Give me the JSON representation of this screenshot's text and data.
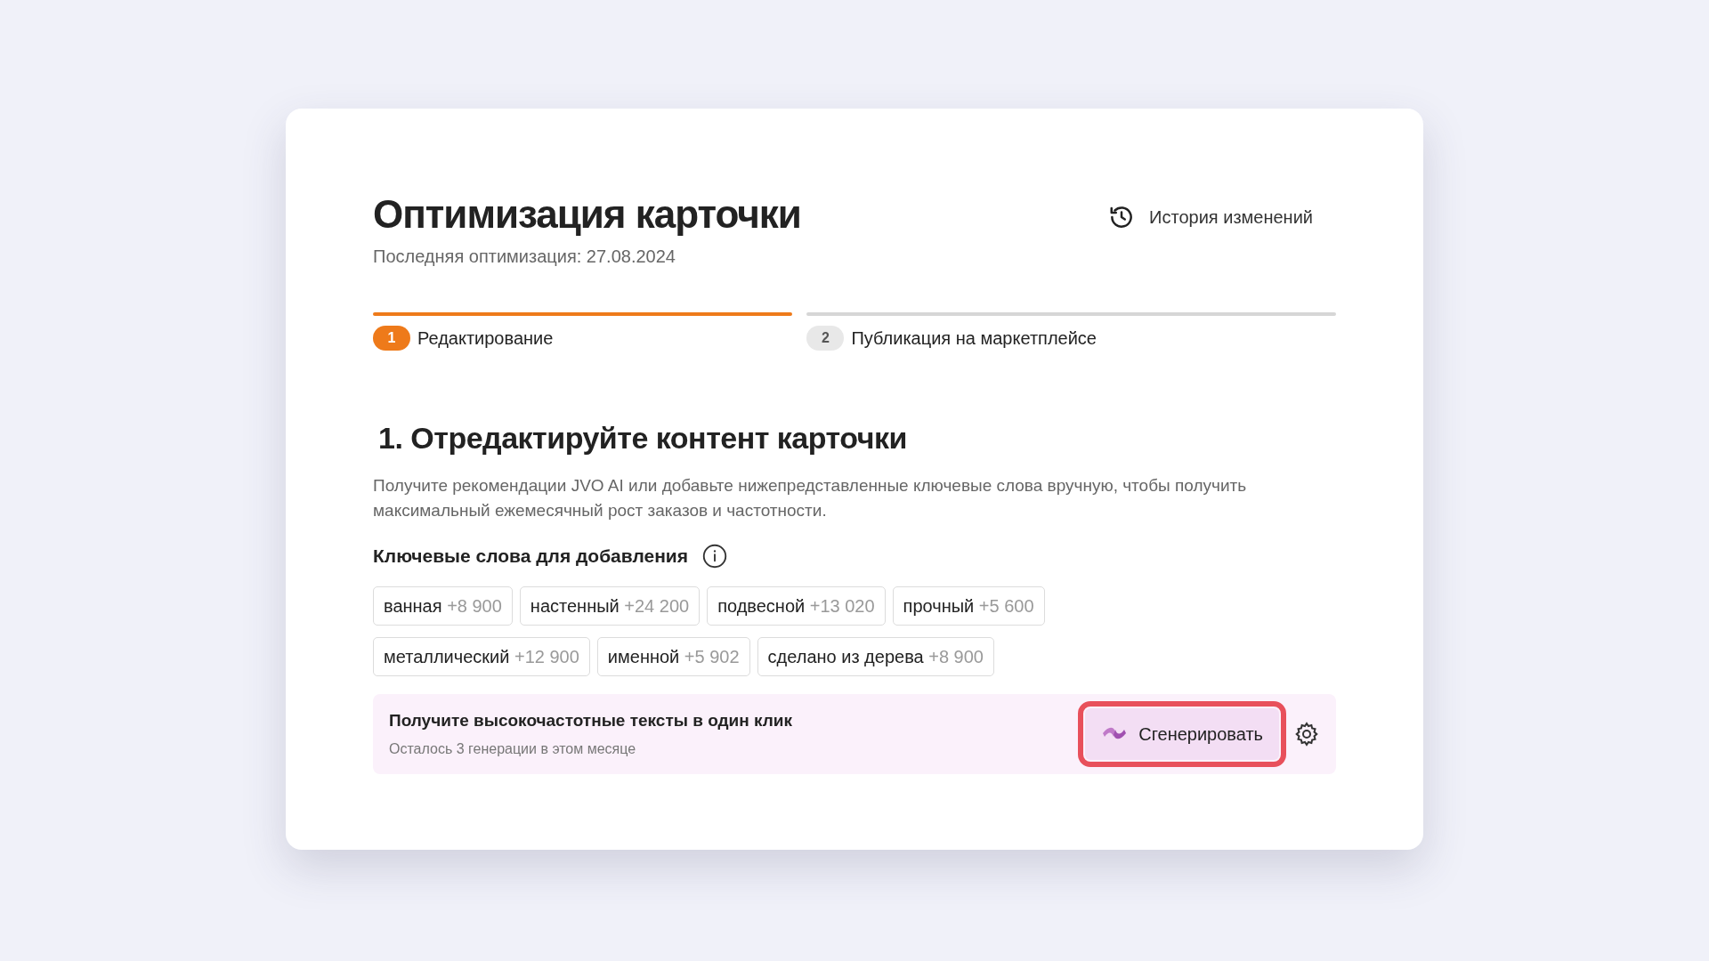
{
  "title": "Оптимизация карточки",
  "subtitle": "Последняя оптимизация: 27.08.2024",
  "history_link": "История изменений",
  "steps": [
    {
      "number": "1",
      "label": "Редактирование",
      "selected": true
    },
    {
      "number": "2",
      "label": "Публикация на маркетплейсе",
      "selected": false
    }
  ],
  "section_heading": "1. Отредактируйте контент карточки",
  "description": "Получите рекомендации JVO AI или добавьте нижепредставленные ключевые слова вручную, чтобы получить максимальный ежемесячный рост заказов и частотности.",
  "keywords_heading": "Ключевые слова для добавления",
  "keywords": [
    {
      "word": "ванная",
      "gain": "+8 900"
    },
    {
      "word": "настенный",
      "gain": "+24 200"
    },
    {
      "word": "подвесной",
      "gain": "+13 020"
    },
    {
      "word": "прочный",
      "gain": "+5 600"
    },
    {
      "word": "металлический",
      "gain": "+12 900"
    },
    {
      "word": "именной",
      "gain": "+5 902"
    },
    {
      "word": "сделано из дерева",
      "gain": "+8 900"
    }
  ],
  "banner": {
    "title": "Получите высокочастотные тексты в один клик",
    "note": "Осталось 3 генерации в этом месяце",
    "button": "Сгенерировать",
    "highlighted": true
  }
}
